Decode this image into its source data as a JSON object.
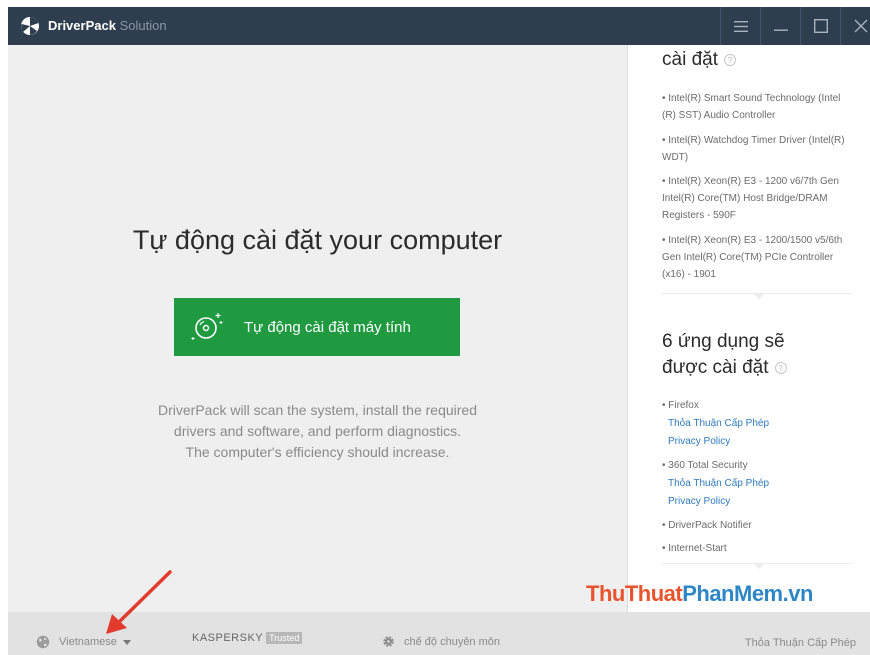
{
  "titlebar": {
    "app_name": "DriverPack",
    "app_suffix": "Solution",
    "icons": [
      "driverpack-logo-icon",
      "menu-icon",
      "minimize-icon",
      "maximize-icon",
      "close-icon"
    ]
  },
  "main": {
    "headline": "Tự động cài đặt your computer",
    "install_button_label": "Tự động cài đặt máy tính",
    "description_lines": [
      "DriverPack will scan the system, install the required",
      "drivers and software, and perform diagnostics.",
      "The computer's efficiency should increase."
    ]
  },
  "right_panel": {
    "drivers_title_tail": "cài đặt",
    "drivers": [
      "• Intel(R) Smart Sound Technology (Intel (R) SST) Audio Controller",
      "• Intel(R) Watchdog Timer Driver (Intel(R) WDT)",
      "• Intel(R) Xeon(R) E3 - 1200 v6/7th Gen Intel(R) Core(TM) Host Bridge/DRAM Registers - 590F",
      "• Intel(R) Xeon(R) E3 - 1200/1500 v5/6th Gen Intel(R) Core(TM) PCIe Controller (x16) - 1901"
    ],
    "apps_title_line1": "6 ứng dụng sẽ",
    "apps_title_line2": "được cài đặt",
    "apps": [
      {
        "name": "• Firefox",
        "links": [
          "Thỏa Thuận Cấp Phép",
          "Privacy Policy"
        ]
      },
      {
        "name": "• 360 Total Security",
        "links": [
          "Thỏa Thuận Cấp Phép",
          "Privacy Policy"
        ]
      },
      {
        "name": "• DriverPack Notifier",
        "links": []
      },
      {
        "name": "• Internet-Start",
        "links": []
      }
    ]
  },
  "bottombar": {
    "language": "Vietnamese",
    "kaspersky": "KASPERSKY",
    "kaspersky_badge": "Trusted",
    "expert_mode": "chế độ chuyên môn",
    "license": "Thỏa Thuận Cấp Phép"
  },
  "watermark": {
    "part1": "ThuThuat",
    "part2": "PhanMem.vn"
  },
  "colors": {
    "titlebar": "#2f3e4f",
    "install_button": "#1f9a41",
    "link": "#2f7bbd",
    "arrow": "#e23b2e"
  }
}
